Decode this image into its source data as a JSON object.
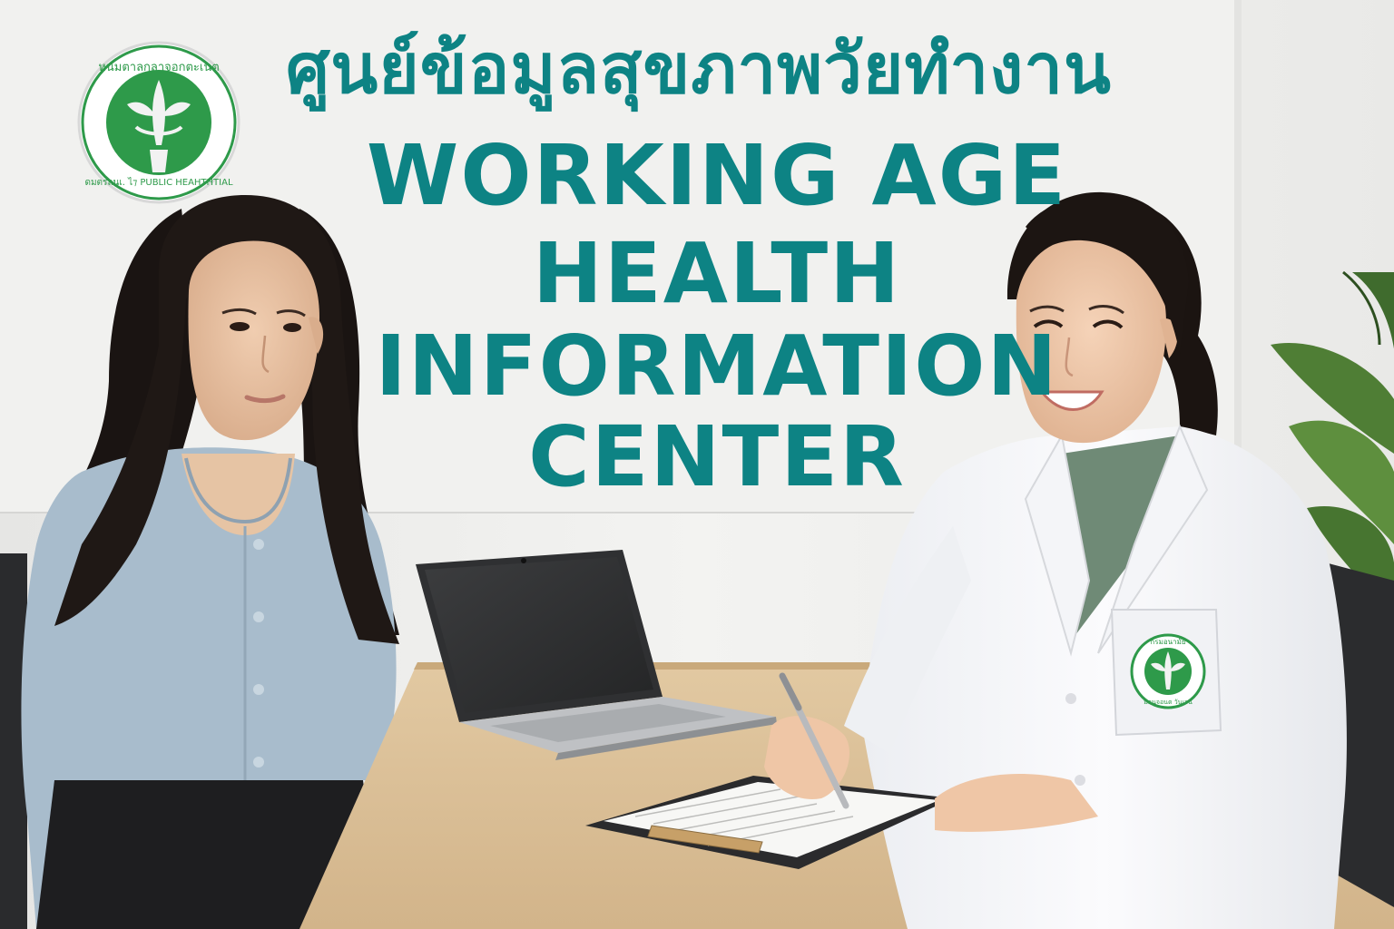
{
  "sign": {
    "thai_title": "ศูนย์ข้อมูลสุขภาพวัยทำงาน",
    "english_lines": [
      "WORKING AGE",
      "HEALTH",
      "INFORMATION",
      "CENTER"
    ]
  },
  "logo": {
    "ring_text_top": "หนมตาลกลาจอกตะเนต",
    "ring_text_bottom": "ดมตรลนเ. ไ⁊ PUBLIC HEAHTHTIAL",
    "colors": {
      "ring": "#ffffff",
      "inner": "#2e9a4a",
      "emblem": "#f2f2f2"
    }
  },
  "badge": {
    "text_top": "กรมอนามัย",
    "text_bottom": "มอนจอนต วันเจน"
  },
  "colors": {
    "sign_text": "#0d8384",
    "wall": "#efefed",
    "desk": "#dcc29b",
    "blouse": "#a8bccc",
    "coat": "#f7f7f9"
  }
}
